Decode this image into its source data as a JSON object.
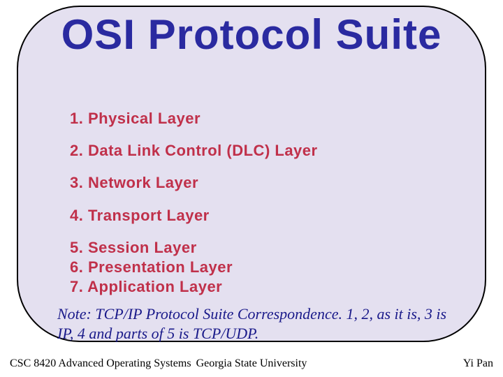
{
  "title": "OSI Protocol Suite",
  "layers": {
    "l1": "1. Physical Layer",
    "l2": "2. Data Link Control (DLC) Layer",
    "l3": "3. Network Layer",
    "l4": "4. Transport Layer",
    "l5": "5. Session Layer",
    "l6": "6. Presentation Layer",
    "l7": "7. Application Layer"
  },
  "note": "Note: TCP/IP Protocol Suite Correspondence. 1, 2, as it is, 3 is IP, 4 and parts of 5 is TCP/UDP.",
  "footer": {
    "left": "CSC 8420 Advanced Operating Systems",
    "center": "Georgia State University",
    "right": "Yi Pan"
  },
  "colors": {
    "title": "#2a2aa0",
    "item": "#c0304a",
    "note": "#1a1a8a",
    "panel": "#e4e0f0"
  }
}
